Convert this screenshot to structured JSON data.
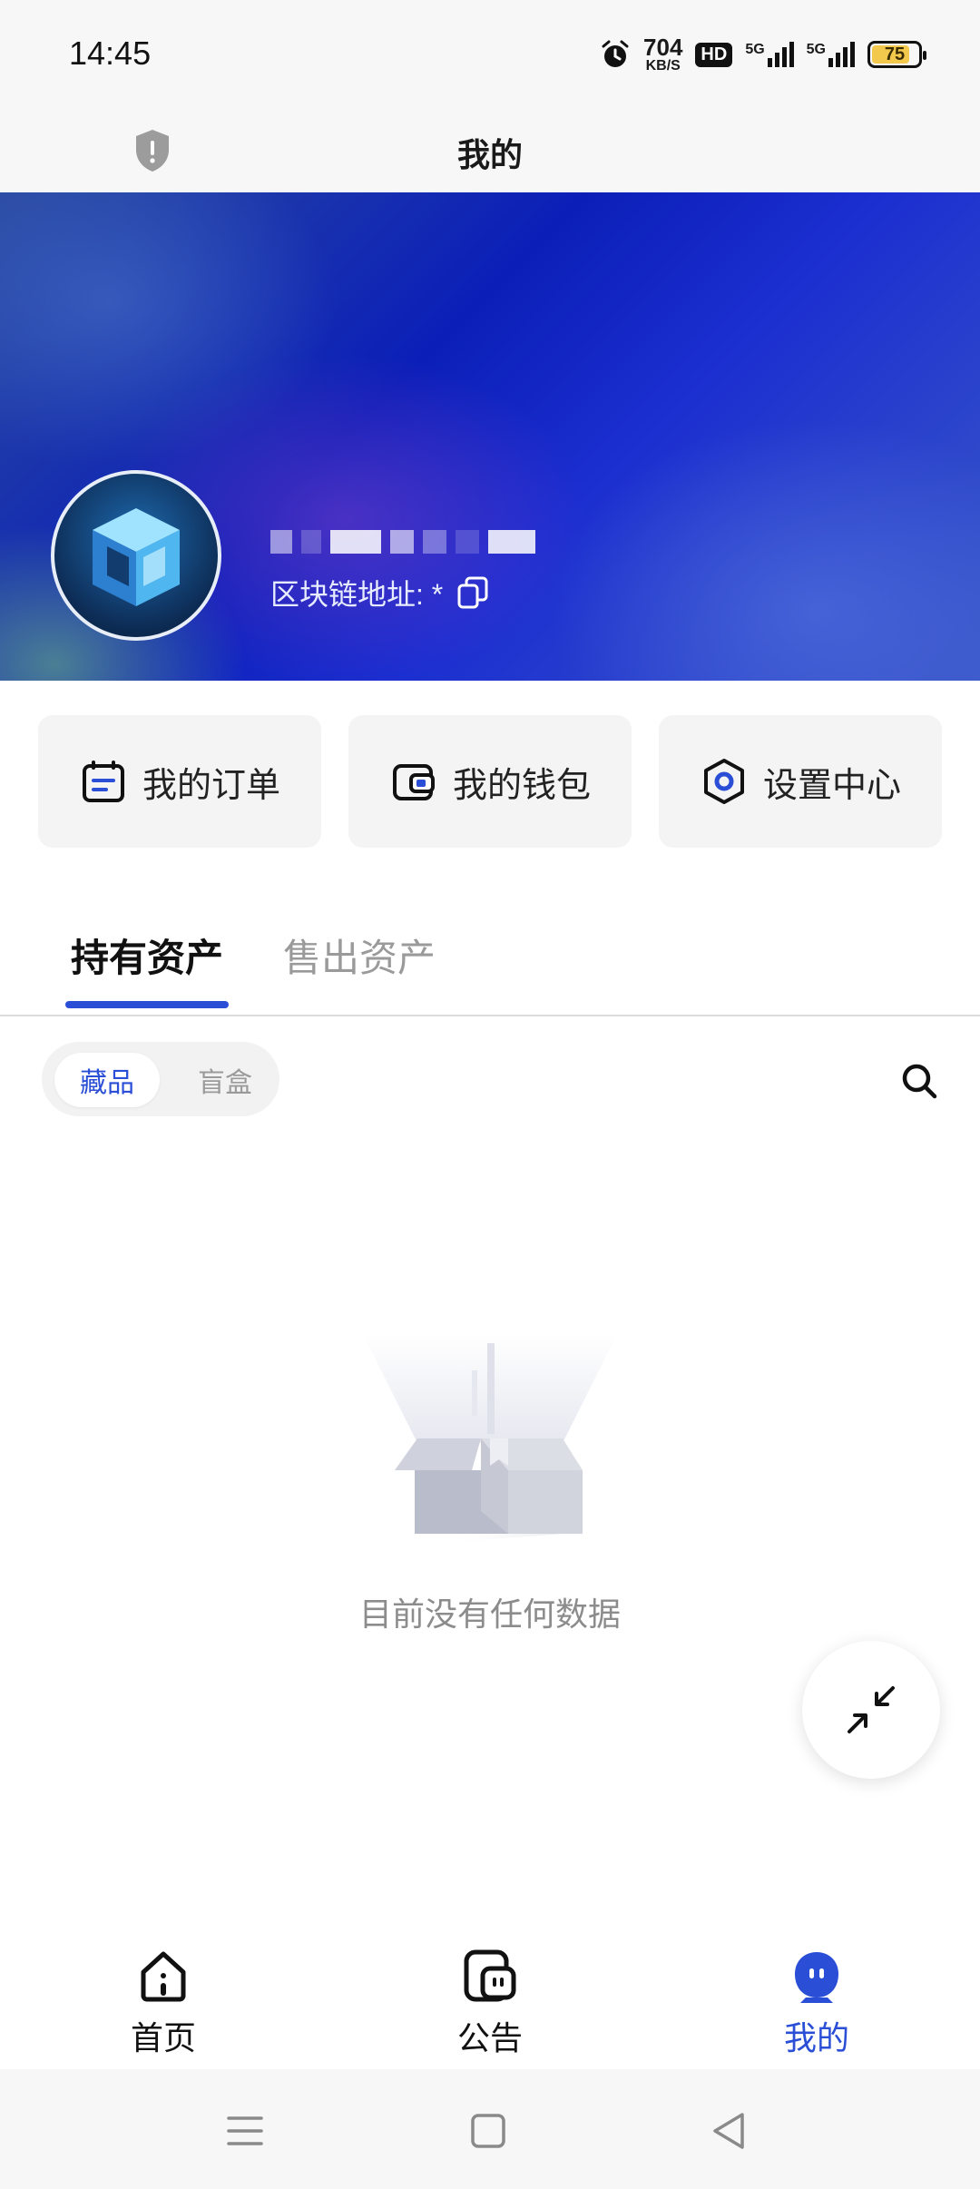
{
  "status_bar": {
    "time": "14:45",
    "net_speed": "704",
    "net_unit": "KB/S",
    "hd_label": "HD",
    "signal_1": "5G",
    "signal_2": "5G",
    "battery": "75"
  },
  "header": {
    "title": "我的",
    "left_icon": "shield-icon"
  },
  "profile": {
    "chain_label": "区块链地址: *",
    "avatar_icon": "cube-logo-icon",
    "copy_icon": "copy-icon"
  },
  "quick_actions": [
    {
      "label": "我的订单",
      "icon": "calendar-icon"
    },
    {
      "label": "我的钱包",
      "icon": "wallet-icon"
    },
    {
      "label": "设置中心",
      "icon": "settings-icon"
    }
  ],
  "tabs": {
    "active": "持有资产",
    "inactive": "售出资产"
  },
  "segment": {
    "selected": "藏品",
    "other": "盲盒"
  },
  "empty_state": {
    "text": "目前没有任何数据"
  },
  "bottom_nav": [
    {
      "label": "首页",
      "icon": "home-icon"
    },
    {
      "label": "公告",
      "icon": "announcement-icon"
    },
    {
      "label": "我的",
      "icon": "profile-icon",
      "active": true
    }
  ],
  "colors": {
    "accent": "#2a4fd6",
    "banner_dark": "#0b1fb8",
    "battery": "#f2c94c"
  }
}
